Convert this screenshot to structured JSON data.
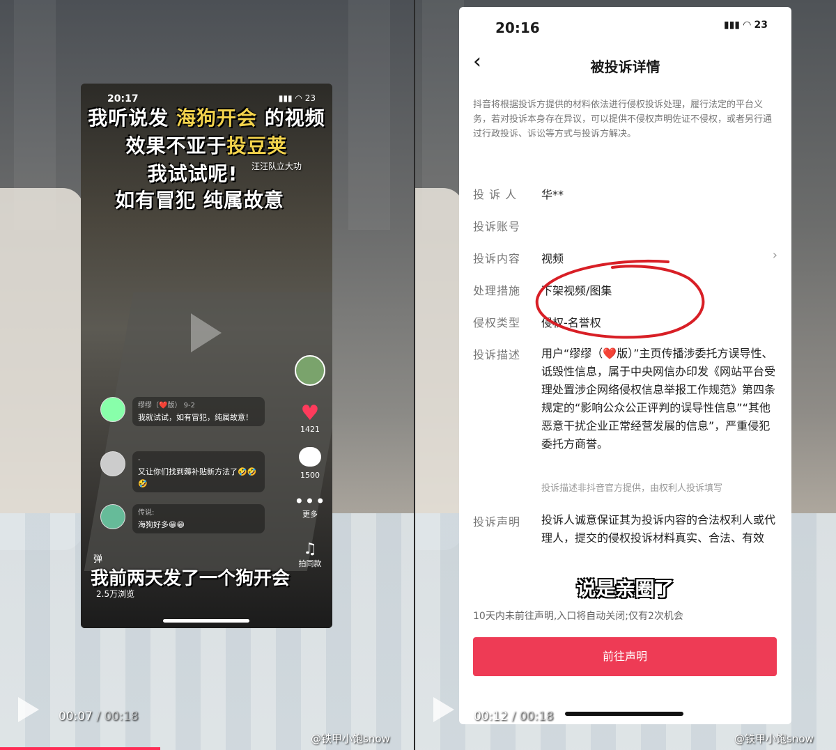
{
  "left": {
    "status_time": "20:17",
    "status_right": "23",
    "overlay_lines": [
      {
        "pre": "我听说发",
        "hl": "海狗开会",
        "post": "的视频"
      },
      {
        "pre": "效果不亚于",
        "hl": "投豆荚",
        "post": ""
      },
      {
        "pre": "我试试呢!",
        "hl": "",
        "post": ""
      },
      {
        "pre": "如有冒犯 纯属故意",
        "hl": "",
        "post": ""
      }
    ],
    "tag": "汪汪队立大功",
    "likes": "1421",
    "comments_count": "1500",
    "more_label": "更多",
    "shoot_label": "拍同款",
    "comments": [
      {
        "name": "缪缪（❤️版） 9-2",
        "text": "我就试试，如有冒犯，纯属故意！"
      },
      {
        "name": "-",
        "text": "又让你们找到薅补贴新方法了🤣🤣🤣"
      },
      {
        "name": "传说:",
        "text": "海狗好多😁😁"
      }
    ],
    "danmu_label": "弹",
    "bottom_caption": "我前两天发了一个狗开会",
    "views": "2.5万浏览",
    "player": {
      "current": "00:07",
      "total": "00:18"
    },
    "watermark": "@铁甲小饱snow"
  },
  "right": {
    "status_time": "20:16",
    "status_right": "23",
    "page_title": "被投诉详情",
    "notice": "抖音将根据投诉方提供的材料依法进行侵权投诉处理，履行法定的平台义务，若对投诉本身存在异议，可以提供不侵权声明佐证不侵权，或者另行通过行政投诉、诉讼等方式与投诉方解决。",
    "rows": [
      {
        "label": "投 诉 人",
        "value": "华**"
      },
      {
        "label": "投诉账号",
        "value": ""
      },
      {
        "label": "投诉内容",
        "value": "视频"
      },
      {
        "label": "处理措施",
        "value": "下架视频/图集"
      },
      {
        "label": "侵权类型",
        "value": "侵权-名誉权"
      },
      {
        "label": "投诉描述",
        "value": ""
      },
      {
        "label": "投诉声明",
        "value": ""
      }
    ],
    "description": "用户“缪缪（❤️版）”主页传播涉委托方误导性、诋毁性信息，属于中央网信办印发《网站平台受理处置涉企网络侵权信息举报工作规范》第四条规定的“影响公众公正评判的误导性信息”“其他恶意干扰企业正常经营发展的信息”，严重侵犯委托方商誉。",
    "description_note": "投诉描述非抖音官方提供，由权利人投诉填写",
    "statement": "投诉人诚意保证其为投诉内容的合法权利人或代理人，提交的侵权投诉材料真实、合法、有效",
    "overlay_caption": "说是亲圈了",
    "expire_note": "10天内未前往声明,入口将自动关闭;仅有2次机会",
    "cta_label": "前往声明",
    "player": {
      "current": "00:12",
      "total": "00:18"
    },
    "watermark": "@铁甲小饱snow"
  }
}
